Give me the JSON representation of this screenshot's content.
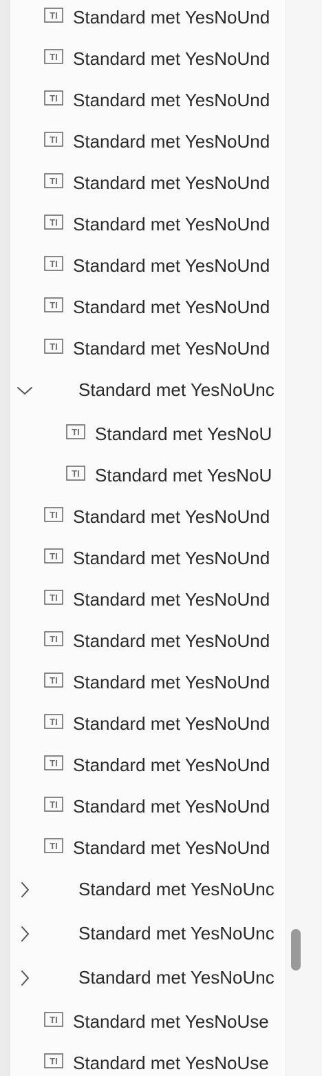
{
  "tree": {
    "rows": [
      {
        "label": "Standard met YesNoUnd",
        "type": "leaf",
        "depth": 1
      },
      {
        "label": "Standard met YesNoUnd",
        "type": "leaf",
        "depth": 1
      },
      {
        "label": "Standard met YesNoUnd",
        "type": "leaf",
        "depth": 1
      },
      {
        "label": "Standard met YesNoUnd",
        "type": "leaf",
        "depth": 1
      },
      {
        "label": "Standard met YesNoUnd",
        "type": "leaf",
        "depth": 1
      },
      {
        "label": "Standard met YesNoUnd",
        "type": "leaf",
        "depth": 1
      },
      {
        "label": "Standard met YesNoUnd",
        "type": "leaf",
        "depth": 1
      },
      {
        "label": "Standard met YesNoUnd",
        "type": "leaf",
        "depth": 1
      },
      {
        "label": "Standard met YesNoUnd",
        "type": "leaf",
        "depth": 1
      },
      {
        "label": "Standard met YesNoUnc",
        "type": "group",
        "expanded": true,
        "depth": 1
      },
      {
        "label": "Standard met YesNoU",
        "type": "leaf",
        "depth": 2
      },
      {
        "label": "Standard met YesNoU",
        "type": "leaf",
        "depth": 2
      },
      {
        "label": "Standard met YesNoUnd",
        "type": "leaf",
        "depth": 1
      },
      {
        "label": "Standard met YesNoUnd",
        "type": "leaf",
        "depth": 1
      },
      {
        "label": "Standard met YesNoUnd",
        "type": "leaf",
        "depth": 1
      },
      {
        "label": "Standard met YesNoUnd",
        "type": "leaf",
        "depth": 1
      },
      {
        "label": "Standard met YesNoUnd",
        "type": "leaf",
        "depth": 1
      },
      {
        "label": "Standard met YesNoUnd",
        "type": "leaf",
        "depth": 1
      },
      {
        "label": "Standard met YesNoUnd",
        "type": "leaf",
        "depth": 1
      },
      {
        "label": "Standard met YesNoUnd",
        "type": "leaf",
        "depth": 1
      },
      {
        "label": "Standard met YesNoUnd",
        "type": "leaf",
        "depth": 1
      },
      {
        "label": "Standard met YesNoUnc",
        "type": "group",
        "expanded": false,
        "depth": 1
      },
      {
        "label": "Standard met YesNoUnc",
        "type": "group",
        "expanded": false,
        "depth": 1
      },
      {
        "label": "Standard met YesNoUnc",
        "type": "group",
        "expanded": false,
        "depth": 1
      },
      {
        "label": "Standard met YesNoUse",
        "type": "leaf",
        "depth": 1
      },
      {
        "label": "Standard met YesNoUse",
        "type": "leaf",
        "depth": 1
      }
    ]
  },
  "icons": {
    "leaf": "text-field-icon",
    "expanded": "chevron-down-icon",
    "collapsed": "chevron-right-icon"
  },
  "colors": {
    "text": "#2a2a2a",
    "icon": "#6b6b6b",
    "scrollbar": "#9a9a9a"
  }
}
